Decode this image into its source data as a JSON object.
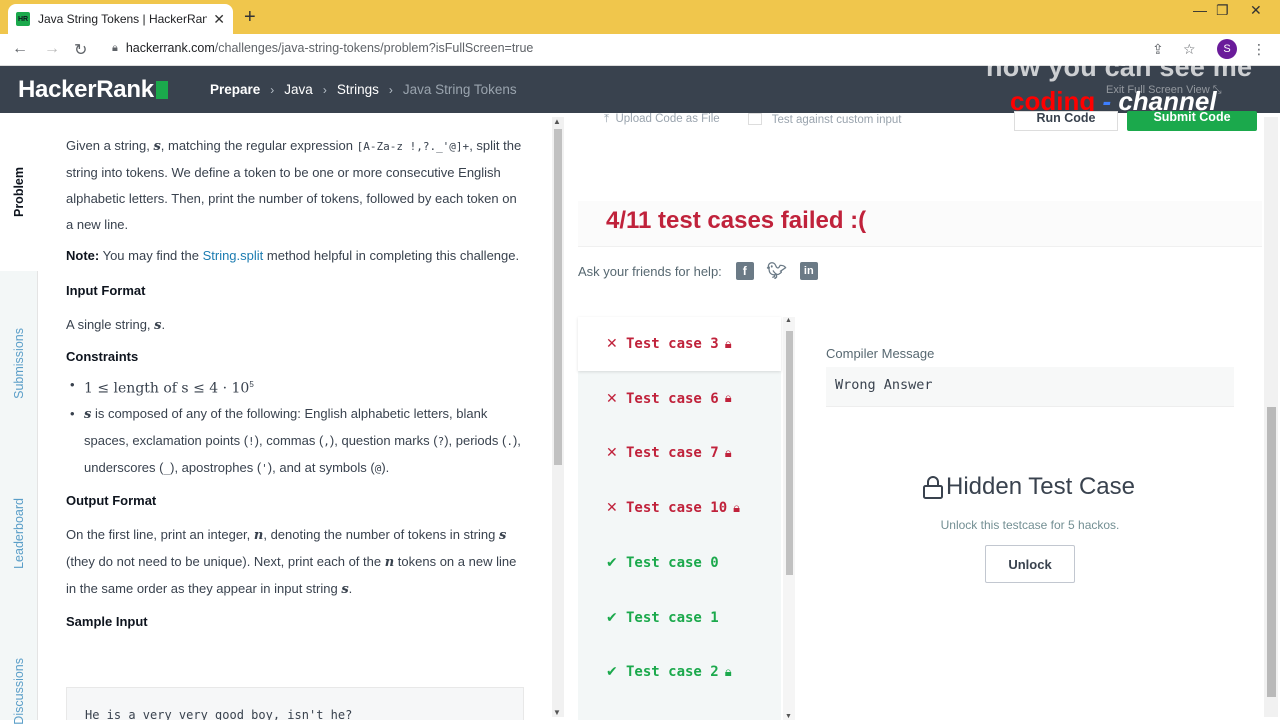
{
  "browser": {
    "tab_title": "Java String Tokens | HackerRank",
    "favicon_text": "HR",
    "url_host": "hackerrank.com",
    "url_path": "/challenges/java-string-tokens/problem?isFullScreen=true",
    "profile_initial": "S"
  },
  "header": {
    "logo": "HackerRank",
    "breadcrumbs": [
      "Prepare",
      "Java",
      "Strings",
      "Java String Tokens"
    ],
    "overlay_line1": "now you can see me",
    "overlay_coding": "coding",
    "overlay_dash": " - ",
    "overlay_channel": "channel",
    "exit_fullscreen": "Exit Full Screen View"
  },
  "side_tabs": [
    "Problem",
    "Submissions",
    "Leaderboard",
    "Discussions"
  ],
  "problem": {
    "intro_1": "Given a string, ",
    "intro_var": "s",
    "intro_2": ", matching the regular expression ",
    "regex": "[A-Za-z !,?._'@]+",
    "intro_3": ", split the string into tokens. We define a token to be one or more consecutive English alphabetic letters. Then, print the number of tokens, followed by each token on a new line.",
    "note_label": "Note:",
    "note_1": " You may find the ",
    "note_link": "String.split",
    "note_2": " method helpful in completing this challenge.",
    "input_format_head": "Input Format",
    "input_format_text": "A single string, ",
    "input_format_var": "s",
    "input_format_end": ".",
    "constraints_head": "Constraints",
    "constraint_1": "1 ≤  length of s ≤ 4 · 10",
    "constraint_1_exp": "5",
    "constraint_2_var": "s",
    "constraint_2_a": " is composed of any of the following: English alphabetic letters, blank spaces, exclamation points (",
    "sym_excl": "!",
    "constraint_2_b": "), commas (",
    "sym_comma": ",",
    "constraint_2_c": "), question marks (",
    "sym_q": "?",
    "constraint_2_d": "), periods (",
    "sym_period": ".",
    "constraint_2_e": "), underscores (",
    "sym_under": "_",
    "constraint_2_f": "), apostrophes (",
    "sym_apos": "'",
    "constraint_2_g": "), and at symbols (",
    "sym_at": "@",
    "constraint_2_h": ").",
    "output_format_head": "Output Format",
    "output_1": "On the first line, print an integer, ",
    "output_var_n": "n",
    "output_2": ", denoting the number of tokens in string ",
    "output_var_s": "s",
    "output_3": " (they do not need to be unique). Next, print each of the ",
    "output_var_n2": "n",
    "output_4": " tokens on a new line in the same order as they appear in input string ",
    "output_var_s2": "s",
    "output_5": ".",
    "sample_input_head": "Sample Input",
    "sample_input": "He is a very very good boy, isn't he?"
  },
  "editor_tools": {
    "upload": "Upload Code as File",
    "custom_input": "Test against custom input",
    "run": "Run Code",
    "submit": "Submit Code"
  },
  "result": {
    "title": "4/11 test cases failed :(",
    "ask": "Ask your friends for help:"
  },
  "test_cases": [
    {
      "label": "Test case 3",
      "status": "fail",
      "locked": true
    },
    {
      "label": "Test case 6",
      "status": "fail",
      "locked": true
    },
    {
      "label": "Test case 7",
      "status": "fail",
      "locked": true
    },
    {
      "label": "Test case 10",
      "status": "fail",
      "locked": true
    },
    {
      "label": "Test case 0",
      "status": "pass",
      "locked": false
    },
    {
      "label": "Test case 1",
      "status": "pass",
      "locked": false
    },
    {
      "label": "Test case 2",
      "status": "pass",
      "locked": true
    }
  ],
  "detail": {
    "compiler_label": "Compiler Message",
    "compiler_message": "Wrong Answer",
    "hidden_title": "Hidden Test Case",
    "unlock_msg": "Unlock this testcase for 5 hackos.",
    "unlock_btn": "Unlock"
  },
  "colors": {
    "brand_green": "#1ba94c",
    "fail_red": "#c0223b",
    "header_dark": "#39424e",
    "tab_yellow": "#f0c64c"
  }
}
